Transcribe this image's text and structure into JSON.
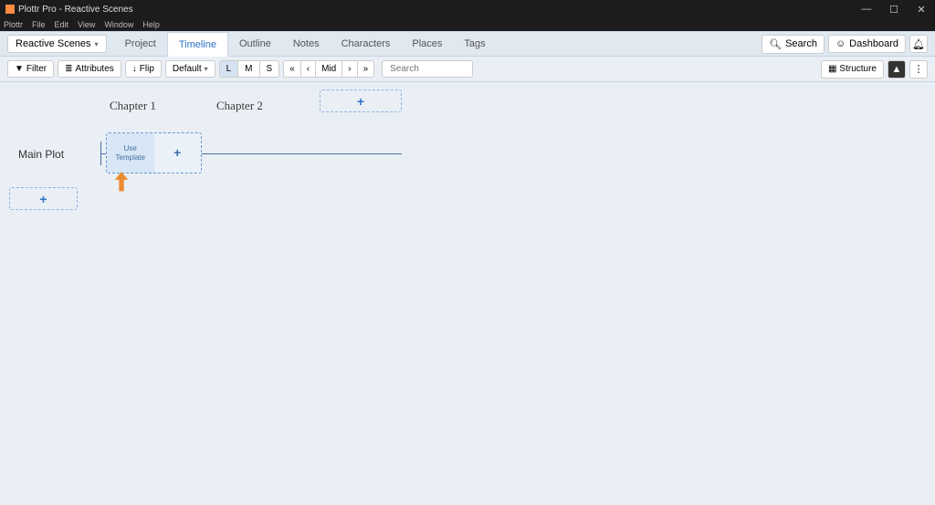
{
  "window": {
    "title": "Plottr Pro - Reactive Scenes"
  },
  "menubar": [
    "Plottr",
    "File",
    "Edit",
    "View",
    "Window",
    "Help"
  ],
  "file_dropdown": "Reactive Scenes",
  "tabs": {
    "project": "Project",
    "timeline": "Timeline",
    "outline": "Outline",
    "notes": "Notes",
    "characters": "Characters",
    "places": "Places",
    "tags": "Tags"
  },
  "nav_right": {
    "search": "Search",
    "dashboard": "Dashboard"
  },
  "toolbar": {
    "filter": "Filter",
    "attributes": "Attributes",
    "flip": "Flip",
    "default": "Default",
    "sizes": {
      "l": "L",
      "m": "M",
      "s": "S"
    },
    "pager": {
      "first": "«",
      "prev": "‹",
      "mid": "Mid",
      "next": "›",
      "last": "»"
    },
    "search_placeholder": "Search",
    "structure": "Structure"
  },
  "timeline": {
    "chapters": [
      "Chapter 1",
      "Chapter 2"
    ],
    "plotline": "Main Plot",
    "card": {
      "use_template": "Use\nTemplate",
      "plus": "+"
    },
    "add": "+"
  },
  "icons": {
    "search": "🔍",
    "user": "👤",
    "bell": "🔔",
    "person_fill": "▪",
    "dots": "⋮",
    "funnel": "▾",
    "list": "≡",
    "flip": "↕",
    "grid": "▦"
  }
}
